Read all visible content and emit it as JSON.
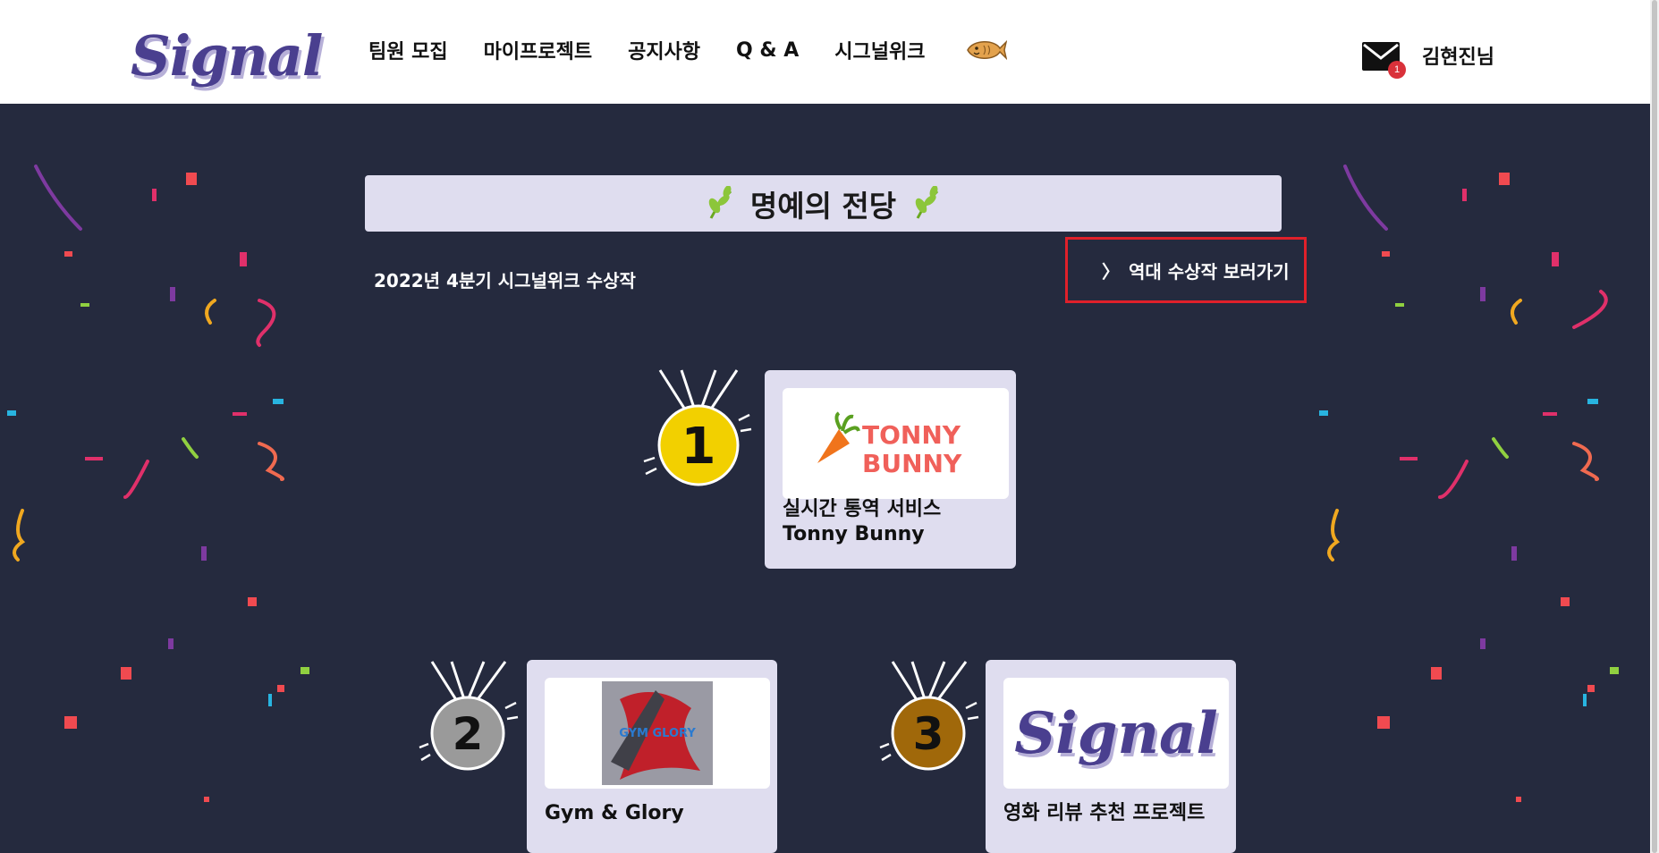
{
  "header": {
    "logo_text": "Signal",
    "nav": [
      "팀원 모집",
      "마이프로젝트",
      "공지사항",
      "Q & A",
      "시그널위크"
    ],
    "fish_icon": "bungeoppang-icon",
    "mail_badge": "1",
    "user_name": "김현진님"
  },
  "main": {
    "title": "명예의 전당",
    "quarter_label": "2022년 4분기 시그널위크 수상작",
    "history_link": "역대 수상작 보러가기",
    "history_chevron": "〉"
  },
  "winners": [
    {
      "rank": "1",
      "medal_color": "#f2d000",
      "title_line1": "실시간 통역 서비스",
      "title_line2": "Tonny Bunny",
      "logo_text_1": "TONNY",
      "logo_text_2": "BUNNY"
    },
    {
      "rank": "2",
      "medal_color": "#9a9a9a",
      "title_line1": "Gym & Glory",
      "logo_text_1": "GYM GLORY"
    },
    {
      "rank": "3",
      "medal_color": "#a0680a",
      "title_line1": "영화 리뷰 추천 프로젝트",
      "logo_text_1": "Signal"
    }
  ],
  "colors": {
    "background": "#252a3e",
    "card": "#dfddef",
    "accent": "#4a3f8f",
    "highlight_border": "#e0202a"
  }
}
